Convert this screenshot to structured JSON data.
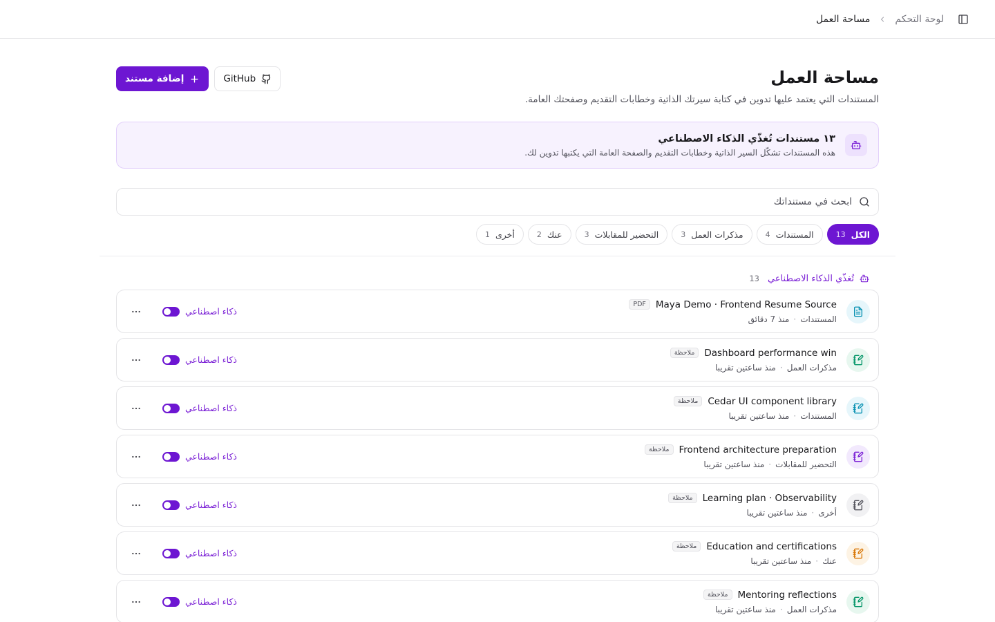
{
  "topbar": {
    "breadcrumb_parent": "لوحة التحكم",
    "breadcrumb_current": "مساحة العمل"
  },
  "page": {
    "title": "مساحة العمل",
    "subtitle": "المستندات التي يعتمد عليها تدوين في كتابة سيرتك الذاتية وخطابات التقديم وصفحتك العامة."
  },
  "actions": {
    "github_label": "GitHub",
    "add_label": "إضافة مستند"
  },
  "banner": {
    "title": "١٣ مستندات تُغذّي الذكاء الاصطناعي",
    "description": "هذه المستندات تشكّل السير الذاتية وخطابات التقديم والصفحة العامة التي يكتبها تدوين لك."
  },
  "search": {
    "placeholder": "ابحث في مستنداتك"
  },
  "filters": [
    {
      "label": "الكل",
      "count": "13",
      "active": true
    },
    {
      "label": "المستندات",
      "count": "4",
      "active": false
    },
    {
      "label": "مذكرات العمل",
      "count": "3",
      "active": false
    },
    {
      "label": "التحضير للمقابلات",
      "count": "3",
      "active": false
    },
    {
      "label": "عنك",
      "count": "2",
      "active": false
    },
    {
      "label": "أخرى",
      "count": "1",
      "active": false
    }
  ],
  "section": {
    "label": "تُغذّي الذكاء الاصطناعي",
    "count": "13"
  },
  "ai_label": "ذكاء اصطناعي",
  "colors": {
    "accent": "#6d16d2",
    "banner_bg": "#f7f2fe"
  },
  "documents": [
    {
      "title": "Maya Demo · Frontend Resume Source",
      "tag": "PDF",
      "category": "المستندات",
      "time": "منذ 7 دقائق",
      "icon": "file-text-icon",
      "icon_color": "#0891b2",
      "icon_bg": "#e6f6fb",
      "ai_enabled": true
    },
    {
      "title": "Dashboard performance win",
      "tag": "ملاحظة",
      "category": "مذكرات العمل",
      "time": "منذ ساعتين تقريبا",
      "icon": "note-edit-icon",
      "icon_color": "#059669",
      "icon_bg": "#e7f7ef",
      "ai_enabled": true
    },
    {
      "title": "Cedar UI component library",
      "tag": "ملاحظة",
      "category": "المستندات",
      "time": "منذ ساعتين تقريبا",
      "icon": "note-edit-icon",
      "icon_color": "#0891b2",
      "icon_bg": "#e6f6fb",
      "ai_enabled": true
    },
    {
      "title": "Frontend architecture preparation",
      "tag": "ملاحظة",
      "category": "التحضير للمقابلات",
      "time": "منذ ساعتين تقريبا",
      "icon": "note-edit-icon",
      "icon_color": "#7c22d6",
      "icon_bg": "#f2e9fd",
      "ai_enabled": true
    },
    {
      "title": "Learning plan · Observability",
      "tag": "ملاحظة",
      "category": "أخرى",
      "time": "منذ ساعتين تقريبا",
      "icon": "note-edit-icon",
      "icon_color": "#52525b",
      "icon_bg": "#f1f1f3",
      "ai_enabled": true
    },
    {
      "title": "Education and certifications",
      "tag": "ملاحظة",
      "category": "عنك",
      "time": "منذ ساعتين تقريبا",
      "icon": "note-edit-icon",
      "icon_color": "#d97706",
      "icon_bg": "#fdf3e4",
      "ai_enabled": true
    },
    {
      "title": "Mentoring reflections",
      "tag": "ملاحظة",
      "category": "مذكرات العمل",
      "time": "منذ ساعتين تقريبا",
      "icon": "note-edit-icon",
      "icon_color": "#059669",
      "icon_bg": "#e7f7ef",
      "ai_enabled": true
    }
  ]
}
